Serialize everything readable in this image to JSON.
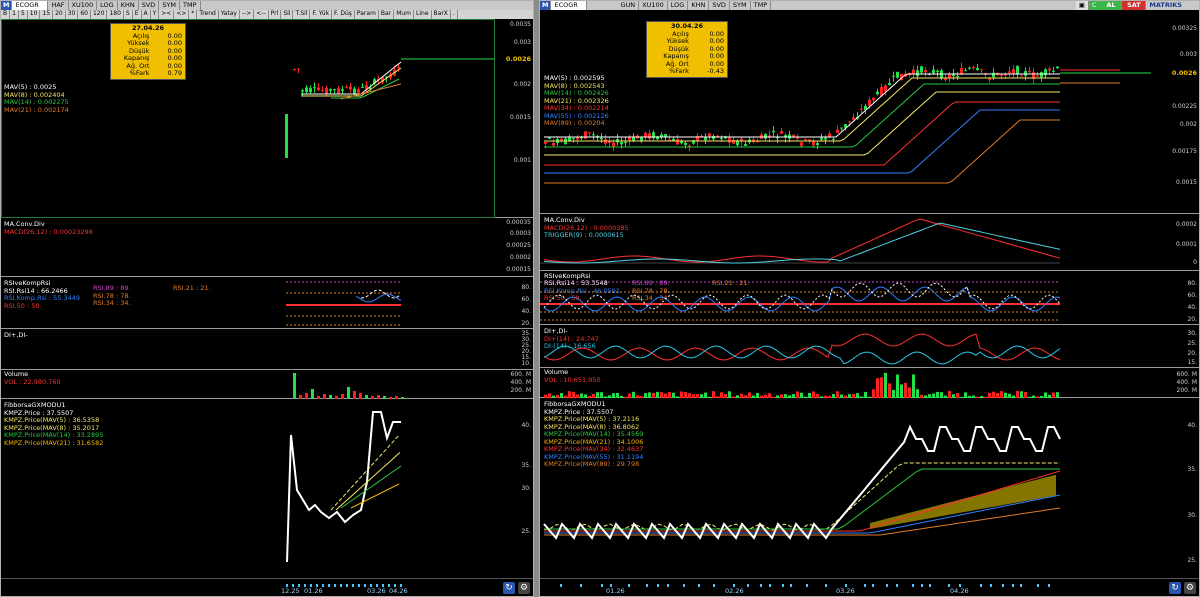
{
  "left": {
    "title": {
      "logo": "M",
      "symbol": "ECOGR",
      "items": [
        "HAF",
        "XU100",
        "LOG",
        "KHN",
        "SVD",
        "SYM",
        "TMP"
      ]
    },
    "toolbar": [
      "B",
      "1",
      "5",
      "10",
      "15",
      "20",
      "30",
      "60",
      "120",
      "180",
      "S",
      "E",
      "A",
      "Y",
      "><",
      "<>",
      "*",
      "Trend",
      "Yatay",
      "-->",
      "<--",
      "Prl",
      "Sil",
      "T.Sil",
      "F. Yük",
      "F. Düş",
      "Param",
      "Bar",
      "Mum",
      "Line",
      "BarX",
      "."
    ],
    "info": {
      "date": "27.04.26",
      "rows": [
        {
          "k": "Açılış",
          "v": "0.00"
        },
        {
          "k": "Yüksek",
          "v": "0.00"
        },
        {
          "k": "Düşük",
          "v": "0.00"
        },
        {
          "k": "Kapanış",
          "v": "0.00"
        },
        {
          "k": "Ağ. Ort",
          "v": "0.00"
        },
        {
          "k": "%Fark",
          "v": "0.79"
        }
      ]
    },
    "price_legend": [
      {
        "name": "MAV(5)",
        "val": ": 0.0025",
        "color": "#ffffff"
      },
      {
        "name": "MAV(8)",
        "val": ": 0.002404",
        "color": "#f5e663"
      },
      {
        "name": "MAV(14)",
        "val": ": 0.002275",
        "color": "#28c840"
      },
      {
        "name": "MAV(21)",
        "val": ": 0.002174",
        "color": "#e07b2a"
      }
    ],
    "price_axis": [
      "0.0035",
      "0.003",
      "0.0026",
      "0.002",
      "0.0015",
      "0.001"
    ],
    "last_price": "0.0026",
    "macd": {
      "title": "MA.Conv.Div",
      "series": "MACD(26,12)",
      "val": ": 0.00023298",
      "axis": [
        "0.00035",
        "0.0003",
        "0.00025",
        "0.0002",
        "0.00015"
      ]
    },
    "rsi": {
      "title": "RSIveKompRsi",
      "rows": [
        {
          "name": "RSI.Rsi14",
          "val": ": 66.2466",
          "color": "#ffffff"
        },
        {
          "name": "RSI.Komp.Rsi",
          "val": ": 55.3449",
          "color": "#2f7fff"
        },
        {
          "name": "RSI.50",
          "val": ": 50.",
          "color": "#ff3030"
        }
      ],
      "extra": [
        {
          "name": "RSI.89",
          "val": ": 89.",
          "color": "#d040d0"
        },
        {
          "name": "RSI.78",
          "val": ": 78.",
          "color": "#e07b2a"
        },
        {
          "name": "RSI.34",
          "val": ": 34.",
          "color": "#e07b2a"
        },
        {
          "name": "RSI.21",
          "val": ": 21.",
          "color": "#e07b2a"
        }
      ],
      "axis": [
        "80.",
        "60.",
        "40.",
        "20."
      ]
    },
    "di": {
      "title": "DI+,DI-",
      "axis": [
        "35.",
        "30.",
        "25.",
        "20.",
        "15.",
        "10."
      ]
    },
    "volume": {
      "title": "Volume",
      "series": "VOL",
      "val": ": 22,980,760",
      "axis": [
        "600. M",
        "400. M",
        "200. M"
      ]
    },
    "fibo": {
      "title": "FibborsaGXMODU1",
      "rows": [
        {
          "name": "KMPZ.Price",
          "val": ": 37.5507",
          "color": "#ffffff"
        },
        {
          "name": "KMPZ.Price(MAV(5)",
          "val": ": 36.5358",
          "color": "#f5e663"
        },
        {
          "name": "KMPZ.Price(MAV(8)",
          "val": ": 35.2017",
          "color": "#f5e663"
        },
        {
          "name": "KMPZ.Price(MAV(14)",
          "val": ": 33.2895",
          "color": "#28c840"
        },
        {
          "name": "KMPZ.Price(MAV(21)",
          "val": ": 31.6582",
          "color": "#f5b400"
        }
      ],
      "axis": [
        "40.",
        "35.",
        "30.",
        "25."
      ]
    },
    "dates": [
      "12.25",
      "01.26",
      "03.26",
      "04.26"
    ]
  },
  "right": {
    "title": {
      "logo": "M",
      "symbol": "ECOGR",
      "items": [
        "GUN",
        "XU100",
        "LOG",
        "KHN",
        "SVD",
        "SYM",
        "TMP"
      ],
      "al": "AL",
      "sat": "SAT",
      "brand": "MATRIKS"
    },
    "info": {
      "date": "30.04.26",
      "rows": [
        {
          "k": "Açılış",
          "v": "0.00"
        },
        {
          "k": "Yüksek",
          "v": "0.00"
        },
        {
          "k": "Düşük",
          "v": "0.00"
        },
        {
          "k": "Kapanış",
          "v": "0.00"
        },
        {
          "k": "Ağ. Ort",
          "v": "0.00"
        },
        {
          "k": "%Fark",
          "v": "-0.43"
        }
      ]
    },
    "price_legend": [
      {
        "name": "MAV(5)",
        "val": ": 0.002595",
        "color": "#ffffff"
      },
      {
        "name": "MAV(8)",
        "val": ": 0.002543",
        "color": "#f5e663"
      },
      {
        "name": "MAV(14)",
        "val": ": 0.002426",
        "color": "#28c840"
      },
      {
        "name": "MAV(21)",
        "val": ": 0.002326",
        "color": "#f5e663"
      },
      {
        "name": "MAV(34)",
        "val": ": 0.002214",
        "color": "#ff3030"
      },
      {
        "name": "MAV(55)",
        "val": ": 0.002126",
        "color": "#2f7fff"
      },
      {
        "name": "MAV(89)",
        "val": ": 0.00204",
        "color": "#e07b2a"
      }
    ],
    "price_axis": [
      "0.00325",
      "0.003",
      "0.0026",
      "0.00225",
      "0.002",
      "0.00175",
      "0.0015"
    ],
    "last_price": "0.0026",
    "macd": {
      "title": "MA.Conv.Div",
      "series": "MACD(26,12)",
      "val": ": 0.0000385",
      "trigger": "TRIGGER(9)",
      "trigger_val": ": 0.0000615",
      "axis": [
        "0.0002",
        "0.0001",
        "0"
      ]
    },
    "rsi": {
      "title": "RSIveKompRsi",
      "rows": [
        {
          "name": "RSI.Rsi14",
          "val": ": 53.3548",
          "color": "#ffffff"
        },
        {
          "name": "RSI.Komp.Rsi",
          "val": ": 46.0591",
          "color": "#2f7fff"
        },
        {
          "name": "RSI.50",
          "val": ": 50.",
          "color": "#ff3030"
        }
      ],
      "extra": [
        {
          "name": "RSI.89",
          "val": ": 89.",
          "color": "#d040d0"
        },
        {
          "name": "RSI.78",
          "val": ": 78.",
          "color": "#e07b2a"
        },
        {
          "name": "RSI.34",
          "val": ": 34.",
          "color": "#e07b2a"
        },
        {
          "name": "RSI.21",
          "val": ": 21.",
          "color": "#e07b2a"
        }
      ],
      "axis": [
        "80.",
        "60.",
        "40.",
        "20."
      ]
    },
    "di": {
      "title": "DI+,DI-",
      "rows": [
        {
          "name": "DI+(14)",
          "val": ": 24.747",
          "color": "#ff3030"
        },
        {
          "name": "DI-(14)",
          "val": ": 16.656",
          "color": "#28c8e8"
        }
      ],
      "axis": [
        "30.",
        "25.",
        "20.",
        "15."
      ]
    },
    "volume": {
      "title": "Volume",
      "series": "VOL",
      "val": ": 10,651,950",
      "axis": [
        "600. M",
        "400. M",
        "200. M"
      ]
    },
    "fibo": {
      "title": "FibborsaGXMODU1",
      "rows": [
        {
          "name": "KMPZ.Price",
          "val": ": 37.5507",
          "color": "#ffffff"
        },
        {
          "name": "KMPZ.Price(MAV(5)",
          "val": ": 37.2116",
          "color": "#f5e663"
        },
        {
          "name": "KMPZ.Price(MAV(8)",
          "val": ": 36.8062",
          "color": "#f5e663"
        },
        {
          "name": "KMPZ.Price(MAV(14)",
          "val": ": 35.4569",
          "color": "#28c840"
        },
        {
          "name": "KMPZ.Price(MAV(21)",
          "val": ": 34.1006",
          "color": "#f5b400"
        },
        {
          "name": "KMPZ.Price(MAV(34)",
          "val": ": 32.4637",
          "color": "#ff3030"
        },
        {
          "name": "KMPZ.Price(MAV(55)",
          "val": ": 31.1194",
          "color": "#2f7fff"
        },
        {
          "name": "KMPZ.Price(MAV(89)",
          "val": ": 29.798",
          "color": "#e07b2a"
        }
      ],
      "axis": [
        "40.",
        "35.",
        "30.",
        "25."
      ]
    },
    "dates": [
      "01.26",
      "02.26",
      "03.26",
      "04.26"
    ]
  },
  "colors": {
    "up": "#22e04a",
    "down": "#ff2020",
    "panel_bg": "#000000",
    "info_bg": "#f0c000",
    "accent": "#2a56b0"
  }
}
